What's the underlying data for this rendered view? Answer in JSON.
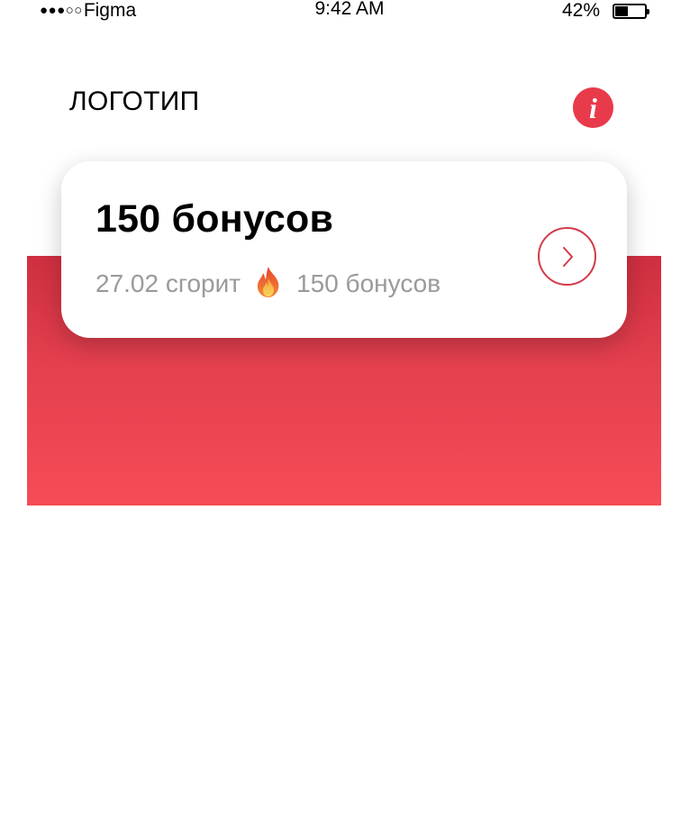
{
  "status_bar": {
    "carrier": "Figma",
    "signal_dots": "●●●○○",
    "time": "9:42 AM",
    "battery_percent": "42%",
    "battery_level": 0.42
  },
  "header": {
    "logo_text": "ЛОГОТИП",
    "info_icon_glyph": "i",
    "info_icon": "info-icon"
  },
  "bonus_card": {
    "title": "150 бонусов",
    "expire_text": "27.02 сгорит",
    "expiring_amount": "150 бонусов",
    "fire_icon": "fire-icon",
    "arrow_icon": "chevron-right-icon"
  },
  "colors": {
    "accent": "#e83a4b",
    "band_top": "#cf2f40",
    "band_bottom": "#f64c56",
    "subtext": "#9a9a9a"
  }
}
